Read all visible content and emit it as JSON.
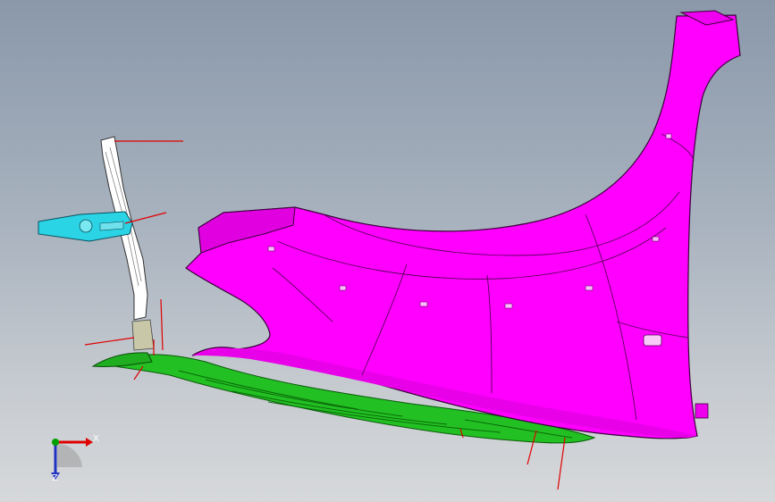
{
  "viewport": {
    "background_top": "#8a98aa",
    "background_bottom": "#d6d8da"
  },
  "model": {
    "fender_color": "#ff00ff",
    "fender_edge_color": "#3a003a",
    "liner_color": "#22c022",
    "bracket_color": "#ffffff",
    "cyan_bracket_color": "#2ad4e4",
    "reference_line_color": "#e00000"
  },
  "triad": {
    "x_label": "X",
    "z_label": "Z",
    "x_color": "#e00000",
    "y_color": "#00a000",
    "z_color": "#2030c0"
  }
}
